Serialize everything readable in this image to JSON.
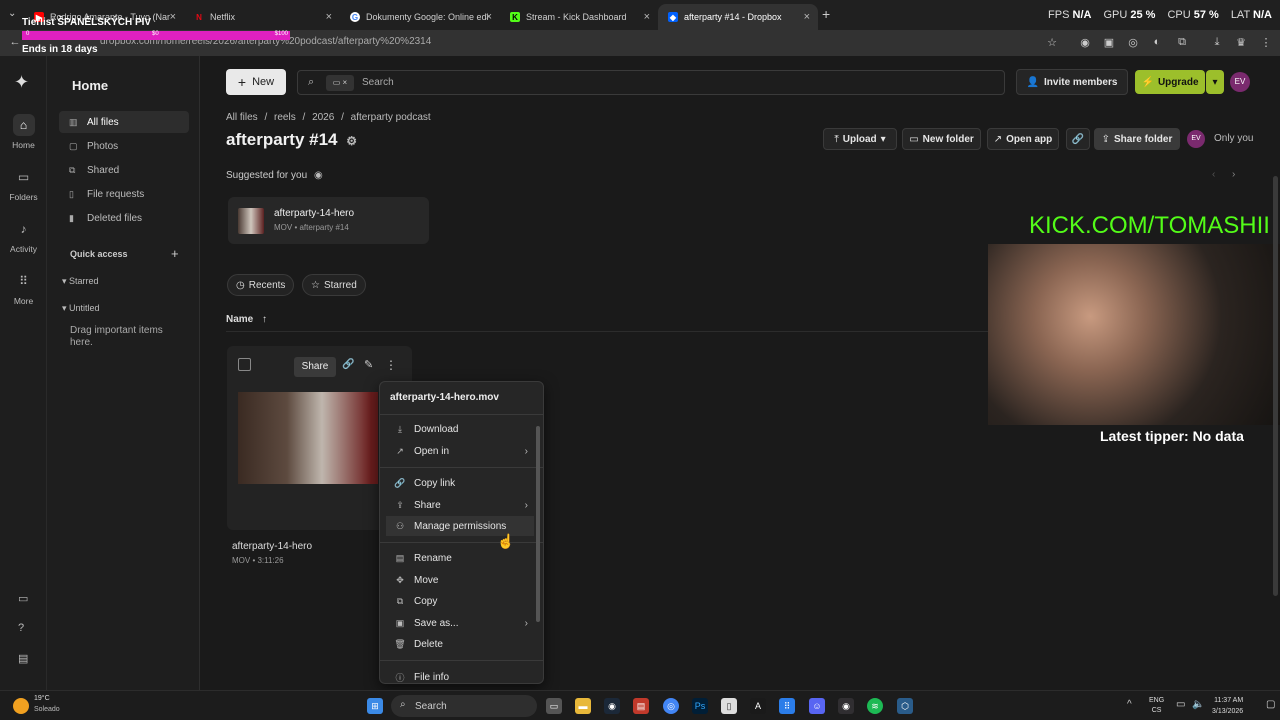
{
  "browser": {
    "tabs": [
      {
        "title": "Rodrigo Amarante - Tuyo (Nar",
        "icon": "youtube-icon",
        "color": "#ff0000"
      },
      {
        "title": "Netflix",
        "icon": "netflix-icon",
        "color": "#e50914"
      },
      {
        "title": "Dokumenty Google: Online edi",
        "icon": "google-icon",
        "color": "#4285f4"
      },
      {
        "title": "Stream - Kick Dashboard",
        "icon": "kick-icon",
        "color": "#53fc18"
      },
      {
        "title": "afterparty #14 - Dropbox",
        "icon": "dropbox-icon",
        "color": "#0061fe"
      }
    ],
    "url": "dropbox.com/home/reels/2026/afterparty%20podcast/afterparty%20%2314",
    "perf": {
      "fps_label": "FPS",
      "fps": "N/A",
      "gpu_label": "GPU",
      "gpu": "25 %",
      "cpu_label": "CPU",
      "cpu": "57 %",
      "lat_label": "LAT",
      "lat": "N/A"
    }
  },
  "stream_overlay": {
    "tierlist": "Tierlist ŠPANĚLSKÝCH PIV",
    "bar_start": "0",
    "bar_mid": "$0",
    "bar_end": "$100",
    "ends": "Ends in 18 days",
    "kick_url": "KICK.COM/TOMASHII",
    "tipper": "Latest tipper: No data"
  },
  "rail": [
    {
      "label": "Home",
      "icon": "home-icon"
    },
    {
      "label": "Folders",
      "icon": "folder-icon"
    },
    {
      "label": "Activity",
      "icon": "bell-icon"
    },
    {
      "label": "More",
      "icon": "grid-icon"
    }
  ],
  "sidebar": {
    "title": "Home",
    "items": [
      "All files",
      "Photos",
      "Shared",
      "File requests",
      "Deleted files"
    ],
    "quick_access": "Quick access",
    "starred": "Starred",
    "untitled": "Untitled",
    "drag_hint": "Drag important items here."
  },
  "toolbar": {
    "new": "New",
    "search_placeholder": "Search",
    "invite": "Invite members",
    "upgrade": "Upgrade",
    "avatar": "EV"
  },
  "breadcrumb": [
    "All files",
    "/",
    "reels",
    "/",
    "2026",
    "/",
    "afterparty podcast"
  ],
  "folder": {
    "title": "afterparty #14",
    "upload": "Upload",
    "new_folder": "New folder",
    "open_app": "Open app",
    "share_folder": "Share folder",
    "only_you": "Only you"
  },
  "suggested": {
    "heading": "Suggested for you",
    "card_name": "afterparty-14-hero",
    "card_meta": "MOV • afterparty #14"
  },
  "filters": {
    "recents": "Recents",
    "starred": "Starred"
  },
  "list": {
    "name_header": "Name"
  },
  "file": {
    "share": "Share",
    "name": "afterparty-14-hero",
    "meta": "MOV • 3:11:26"
  },
  "context_menu": {
    "header": "afterparty-14-hero.mov",
    "items": [
      "Download",
      "Open in",
      "Copy link",
      "Share",
      "Manage permissions",
      "Rename",
      "Move",
      "Copy",
      "Save as...",
      "Delete",
      "File info"
    ]
  },
  "taskbar": {
    "weather_temp": "19°C",
    "weather_desc": "Soleado",
    "search": "Search",
    "lang": "ENG",
    "lang2": "CS",
    "time": "11:37 AM",
    "date": "3/13/2026"
  }
}
